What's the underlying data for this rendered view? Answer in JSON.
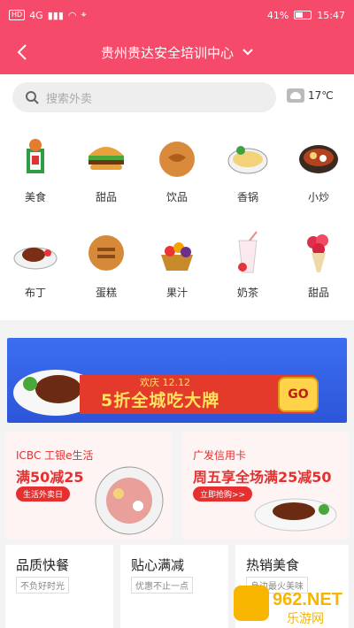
{
  "status_bar": {
    "signal_chip": "HD",
    "network": "4G",
    "battery": "41%",
    "time": "15:47"
  },
  "header": {
    "title": "贵州贵达安全培训中心",
    "back_icon": "chevron-left-icon",
    "dropdown_icon": "chevron-down-icon"
  },
  "search": {
    "placeholder": "搜索外卖"
  },
  "weather": {
    "temp": "17℃",
    "icon": "cloud-icon"
  },
  "categories": [
    {
      "label": "美食"
    },
    {
      "label": "甜品"
    },
    {
      "label": "饮品"
    },
    {
      "label": "香锅"
    },
    {
      "label": "小炒"
    },
    {
      "label": "布丁"
    },
    {
      "label": "蛋糕"
    },
    {
      "label": "果汁"
    },
    {
      "label": "奶茶"
    },
    {
      "label": "甜品"
    }
  ],
  "banner": {
    "subtitle": "欢庆 12.12",
    "title": "5折全城吃大牌",
    "button": "GO"
  },
  "promos": [
    {
      "brand": "ICBC 工银e生活",
      "headline": "满50减25",
      "button": "生活外卖日"
    },
    {
      "brand": "广发信用卡",
      "headline": "周五享全场满25减50",
      "button": "立即抢购>>"
    }
  ],
  "bottom_cards": [
    {
      "title": "品质快餐",
      "sub": "不负好时光"
    },
    {
      "title": "贴心满减",
      "sub": "优惠不止一点"
    },
    {
      "title": "热销美食",
      "sub": "身边最火美味"
    }
  ],
  "watermark": {
    "text": "962.NET",
    "sub": "乐游网"
  },
  "colors": {
    "brand": "#f64a6a",
    "promo_red": "#e5302f",
    "banner_blue": "#3c6ef2"
  }
}
